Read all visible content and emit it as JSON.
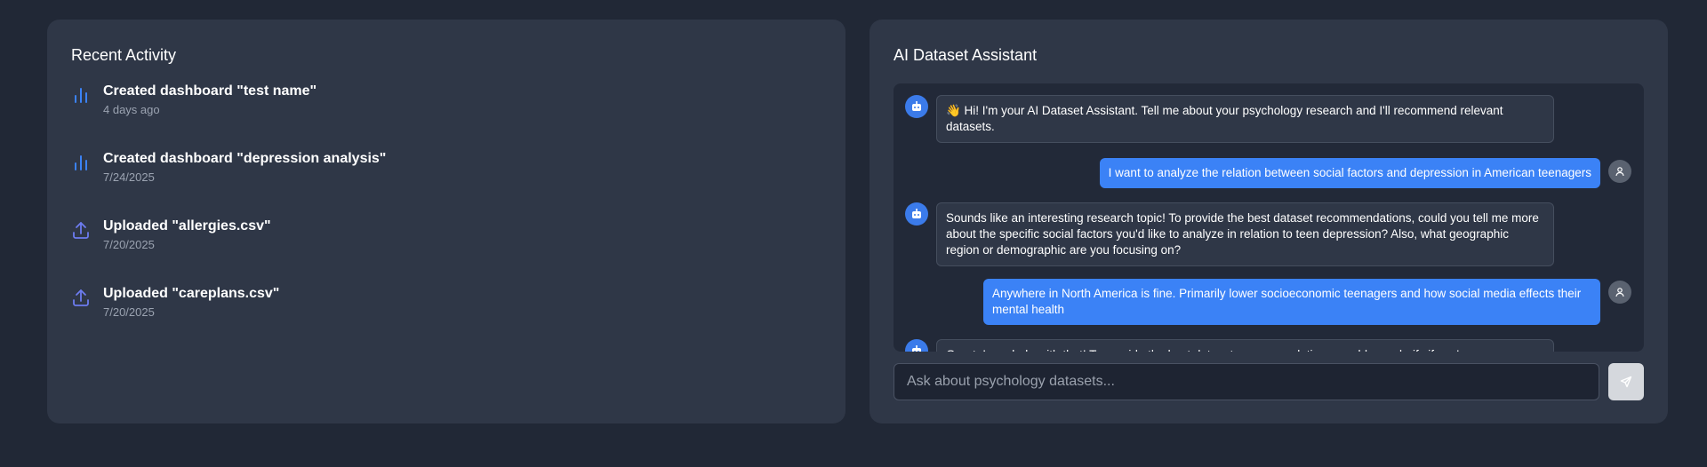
{
  "activity": {
    "title": "Recent Activity",
    "items": [
      {
        "icon": "bar-chart-icon",
        "title": "Created dashboard \"test name\"",
        "time": "4 days ago"
      },
      {
        "icon": "bar-chart-icon",
        "title": "Created dashboard \"depression analysis\"",
        "time": "7/24/2025"
      },
      {
        "icon": "upload-icon",
        "title": "Uploaded \"allergies.csv\"",
        "time": "7/20/2025"
      },
      {
        "icon": "upload-icon",
        "title": "Uploaded \"careplans.csv\"",
        "time": "7/20/2025"
      }
    ]
  },
  "assistant": {
    "title": "AI Dataset Assistant",
    "messages": [
      {
        "role": "bot",
        "text": "👋 Hi! I'm your AI Dataset Assistant. Tell me about your psychology research and I'll recommend relevant datasets."
      },
      {
        "role": "user",
        "text": "I want to analyze the relation between social factors and depression in American teenagers"
      },
      {
        "role": "bot",
        "text": "Sounds like an interesting research topic! To provide the best dataset recommendations, could you tell me more about the specific social factors you'd like to analyze in relation to teen depression? Also, what geographic region or demographic are you focusing on?"
      },
      {
        "role": "user",
        "text": "Anywhere in North America is fine. Primarily lower socioeconomic teenagers and how social media effects their mental health"
      },
      {
        "role": "bot",
        "text": "Great, I can help with that! To provide the best dataset recommendations, could you clarify if you're"
      }
    ],
    "input_placeholder": "Ask about psychology datasets..."
  },
  "colors": {
    "accent": "#3b82f6",
    "activity_icon_chart": "#3b82f6",
    "activity_icon_upload": "#6d7cf0"
  }
}
